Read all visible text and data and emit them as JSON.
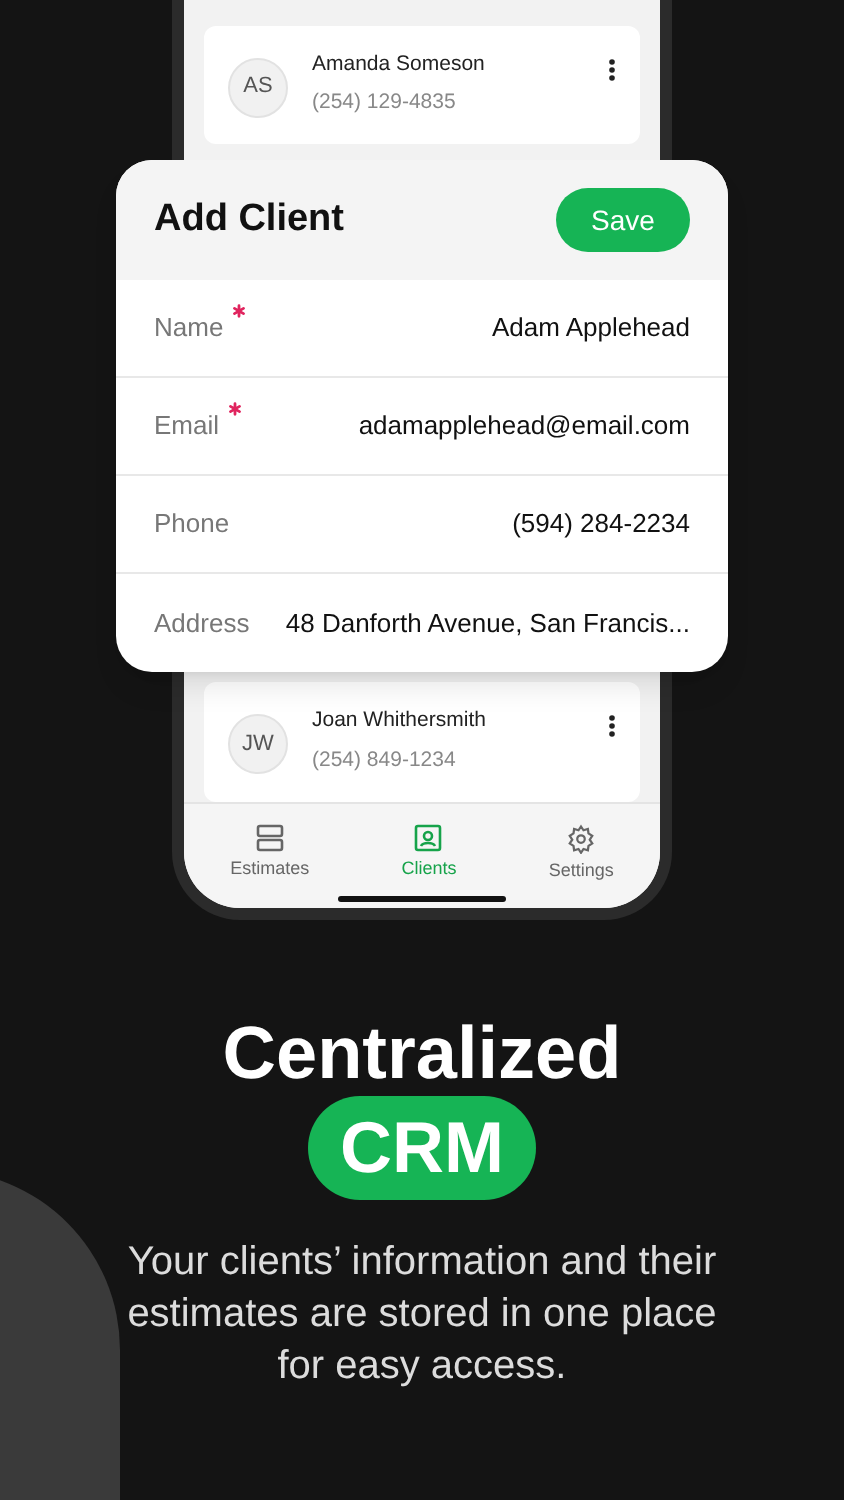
{
  "clients_top": [
    {
      "initials": "AS",
      "name": "Amanda Someson",
      "phone": "(254) 129-4835"
    }
  ],
  "dialog": {
    "title": "Add Client",
    "save": "Save",
    "fields": [
      {
        "label": "Name",
        "value": "Adam Applehead",
        "required": true
      },
      {
        "label": "Email",
        "value": "adamapplehead@email.com",
        "required": true
      },
      {
        "label": "Phone",
        "value": "(594) 284-2234",
        "required": false
      },
      {
        "label": "Address",
        "value": "48 Danforth Avenue, San Francis...",
        "required": false
      }
    ]
  },
  "clients_bottom": [
    {
      "initials": "JW",
      "name": "Joan Whithersmith",
      "phone": "(254) 849-1234"
    }
  ],
  "tabs": [
    {
      "label": "Estimates",
      "kind": "estimates",
      "selected": false
    },
    {
      "label": "Clients",
      "kind": "clients",
      "selected": true
    },
    {
      "label": "Settings",
      "kind": "settings",
      "selected": false
    }
  ],
  "headline": "Centralized",
  "highlight": "CRM",
  "description": "Your clients’ information and their estimates are stored in one place for easy access."
}
